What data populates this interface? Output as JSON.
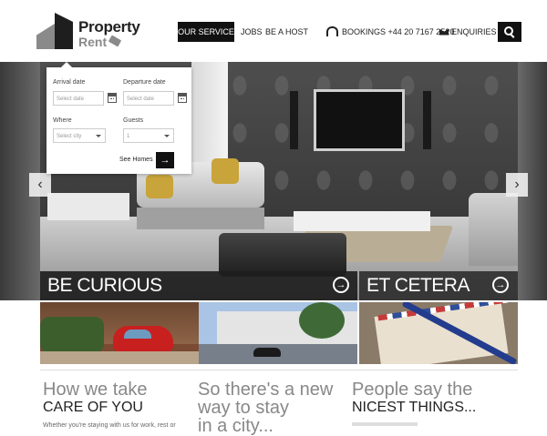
{
  "brand": {
    "name": "Property",
    "sub": "Rent"
  },
  "nav": {
    "service": "OUR SERVICE",
    "jobs": "JOBS",
    "host": "BE A HOST",
    "bookings": "BOOKINGS +44 20 7167 2520",
    "enquiries": "ENQUIRIES"
  },
  "booking_form": {
    "arrival_label": "Arrival date",
    "arrival_placeholder": "Select date",
    "departure_label": "Departure date",
    "departure_placeholder": "Select date",
    "where_label": "Where",
    "where_value": "Select city",
    "guests_label": "Guests",
    "guests_value": "1",
    "see_homes": "See Homes"
  },
  "hero": {
    "caption_main": "BE CURIOUS",
    "caption_side": "ET CETERA"
  },
  "columns": [
    {
      "light": "How we take",
      "dark": "CARE OF YOU",
      "small": "Whether you're staying with us for work, rest or"
    },
    {
      "light": "So there's a new",
      "dark": "way to stay",
      "extra": "in a city..."
    },
    {
      "light": "People say the",
      "dark": "NICEST THINGS..."
    }
  ],
  "icons": {
    "arrow_left": "‹",
    "arrow_right": "›",
    "go": "→",
    "circle_arrow": "→"
  }
}
